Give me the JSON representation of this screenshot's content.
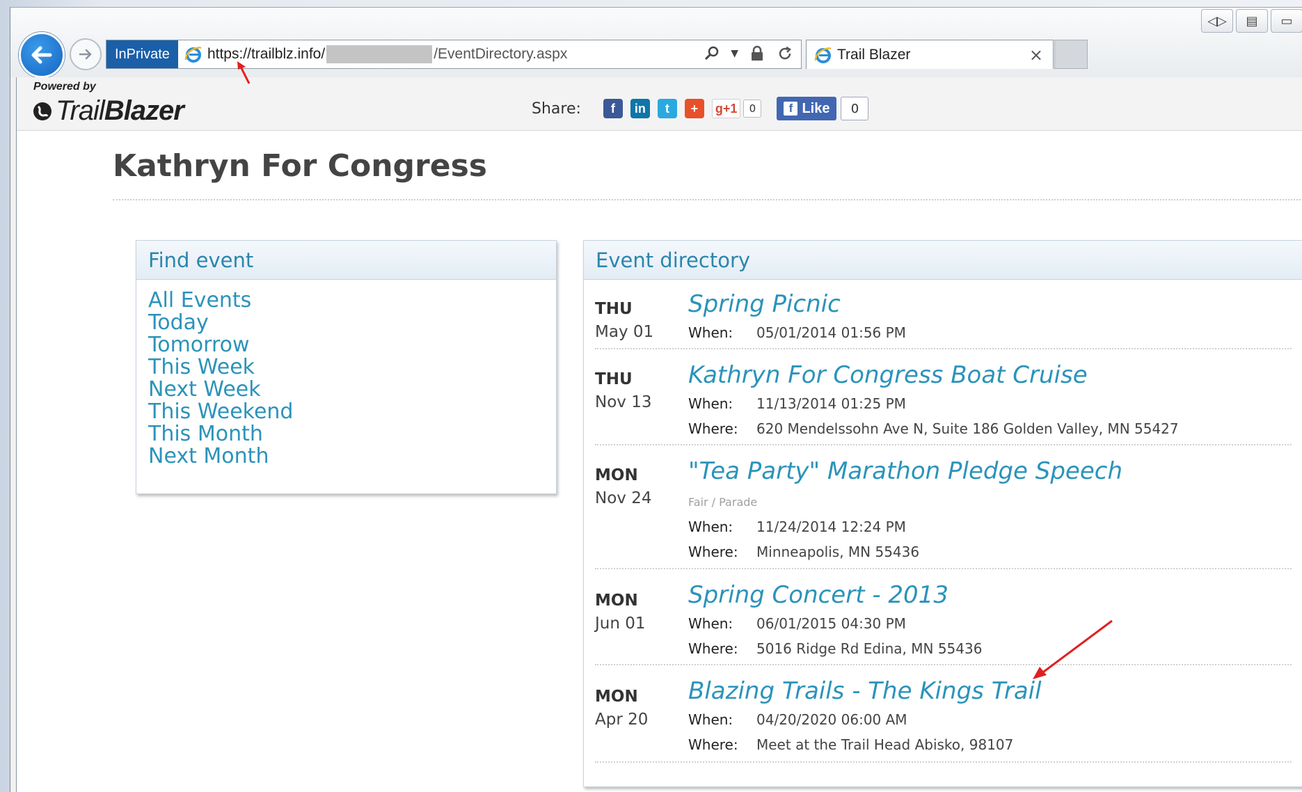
{
  "browser": {
    "inprivate_label": "InPrivate",
    "url_prefix": "https://trailblz.info/",
    "url_suffix": "/EventDirectory.aspx",
    "tab_title": "Trail Blazer",
    "tab_close": "×"
  },
  "site": {
    "powered_by": "Powered by",
    "logo_trail": "Trail",
    "logo_blazer": "Blazer",
    "share_label": "Share:",
    "gplus_label": "g+1",
    "gplus_count": "0",
    "fb_like_label": "Like",
    "fb_like_count": "0"
  },
  "page_title": "Kathryn For Congress",
  "find_event": {
    "heading": "Find event",
    "items": [
      "All Events",
      "Today",
      "Tomorrow",
      "This Week",
      "Next Week",
      "This Weekend",
      "This Month",
      "Next Month"
    ]
  },
  "event_directory": {
    "heading": "Event directory",
    "when_label": "When:",
    "where_label": "Where:",
    "events": [
      {
        "day": "THU",
        "date": "May 01",
        "title": "Spring Picnic",
        "category": "",
        "when": "05/01/2014 01:56 PM",
        "where": ""
      },
      {
        "day": "THU",
        "date": "Nov 13",
        "title": "Kathryn For Congress Boat Cruise",
        "category": "",
        "when": "11/13/2014 01:25 PM",
        "where": "620 Mendelssohn Ave N, Suite 186 Golden Valley, MN 55427"
      },
      {
        "day": "MON",
        "date": "Nov 24",
        "title": "\"Tea Party\" Marathon Pledge Speech",
        "category": "Fair / Parade",
        "when": "11/24/2014 12:24 PM",
        "where": "Minneapolis, MN 55436"
      },
      {
        "day": "MON",
        "date": "Jun 01",
        "title": "Spring Concert - 2013",
        "category": "",
        "when": "06/01/2015 04:30 PM",
        "where": "5016 Ridge Rd Edina, MN 55436"
      },
      {
        "day": "MON",
        "date": "Apr 20",
        "title": "Blazing Trails - The Kings Trail",
        "category": "",
        "when": "04/20/2020 06:00 AM",
        "where": "Meet at the Trail Head Abisko, 98107"
      }
    ]
  },
  "colors": {
    "link": "#2b93ba",
    "inprivate_bg": "#1a5fa8",
    "annotation_arrow": "#e02020"
  }
}
